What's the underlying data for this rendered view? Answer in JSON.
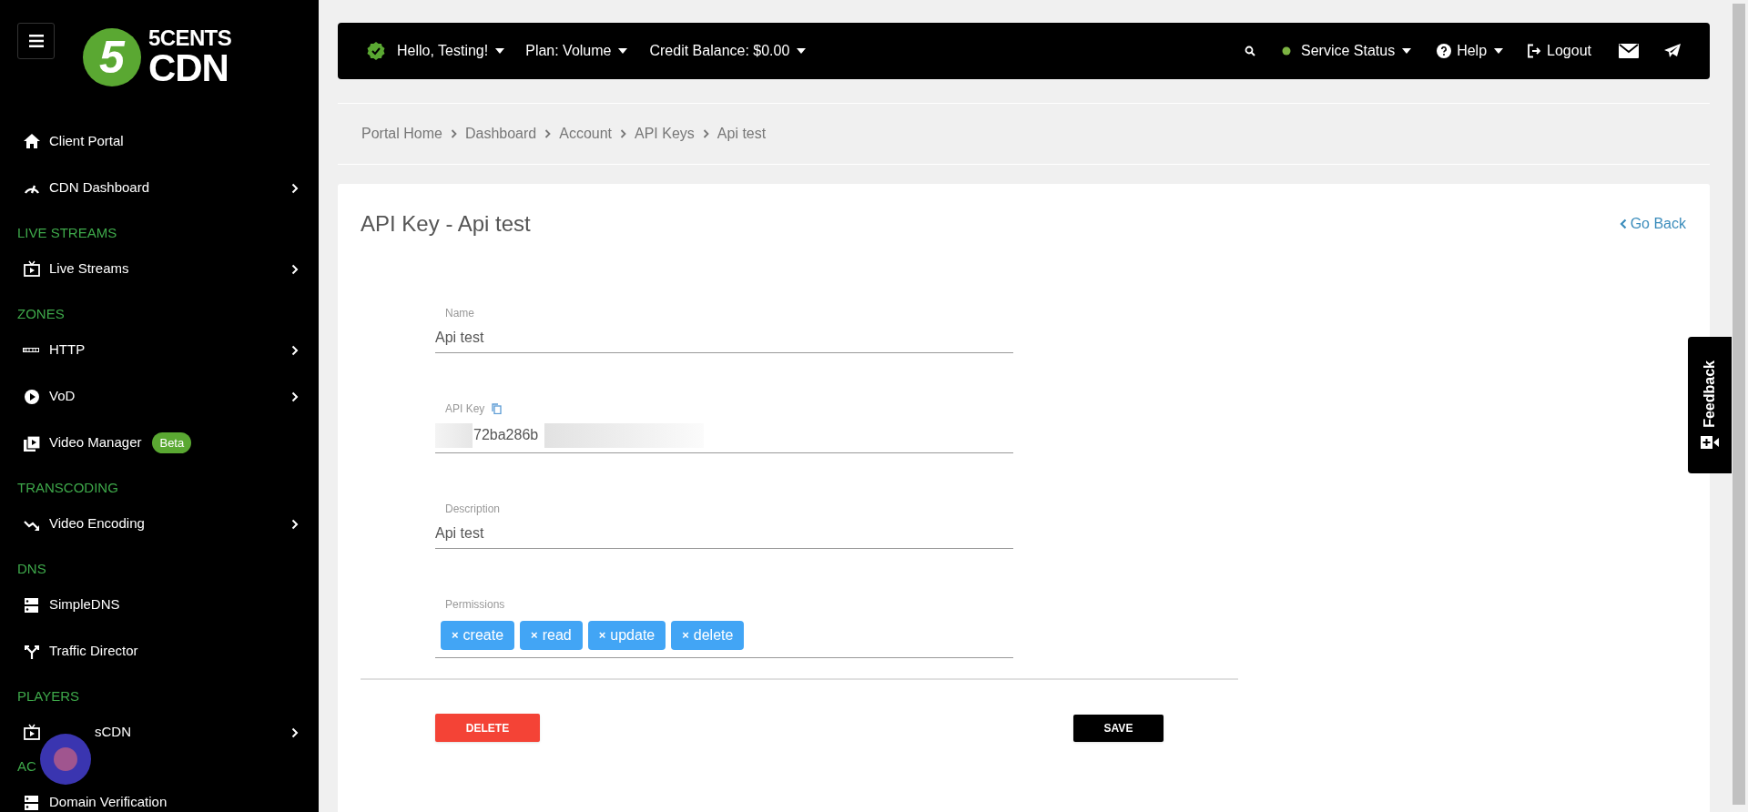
{
  "sidebar": {
    "logo": {
      "digit": "5",
      "line_1": "5CENTS",
      "line_2": "CDN"
    },
    "items": [
      {
        "kind": "link",
        "label": "Client Portal",
        "submenu": false
      },
      {
        "kind": "link",
        "label": "CDN Dashboard",
        "submenu": true
      },
      {
        "kind": "heading",
        "label": "LIVE STREAMS"
      },
      {
        "kind": "link",
        "label": "Live Streams",
        "submenu": true
      },
      {
        "kind": "heading",
        "label": "ZONES"
      },
      {
        "kind": "link",
        "label": "HTTP",
        "submenu": true
      },
      {
        "kind": "link",
        "label": "VoD",
        "submenu": true
      },
      {
        "kind": "link",
        "label": "Video Manager",
        "submenu": false,
        "badge": "Beta"
      },
      {
        "kind": "heading",
        "label": "TRANSCODING"
      },
      {
        "kind": "link",
        "label": "Video Encoding",
        "submenu": true
      },
      {
        "kind": "heading",
        "label": "DNS"
      },
      {
        "kind": "link",
        "label": "SimpleDNS",
        "submenu": false
      },
      {
        "kind": "link",
        "label": "Traffic Director",
        "submenu": false
      },
      {
        "kind": "heading",
        "label": "PLAYERS"
      },
      {
        "kind": "link",
        "label": "sCDN",
        "submenu": true
      },
      {
        "kind": "heading",
        "label": "AC"
      },
      {
        "kind": "link",
        "label": "Domain Verification",
        "submenu": false
      }
    ]
  },
  "top_bar": {
    "user_menu": "Hello, Testing!",
    "plan_menu": "Plan: Volume",
    "credit_menu": "Credit Balance: $0.00",
    "service_status": "Service Status",
    "help": "Help",
    "logout": "Logout"
  },
  "breadcrumb": [
    "Portal Home",
    "Dashboard",
    "Account",
    "API Keys",
    "Api test"
  ],
  "card": {
    "title": "API Key - Api test",
    "go_back": "Go Back",
    "fields": [
      {
        "kind": "text",
        "label": "Name",
        "value": "Api test"
      },
      {
        "kind": "secret",
        "label": "API Key",
        "value": "72ba286b"
      },
      {
        "kind": "text",
        "label": "Description",
        "value": "Api test"
      },
      {
        "kind": "tags",
        "label": "Permissions",
        "remove_glyph": "×",
        "tags": [
          "create",
          "read",
          "update",
          "delete"
        ]
      }
    ],
    "delete_button": "DELETE",
    "save_button": "SAVE"
  },
  "feedback_tab": "Feedback"
}
